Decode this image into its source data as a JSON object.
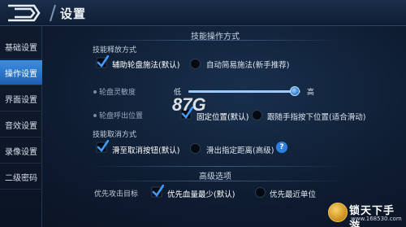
{
  "header": {
    "title": "设置"
  },
  "sidebar": {
    "items": [
      {
        "label": "基础设置",
        "active": false
      },
      {
        "label": "操作设置",
        "active": true
      },
      {
        "label": "界面设置",
        "active": false
      },
      {
        "label": "音效设置",
        "active": false
      },
      {
        "label": "录像设置",
        "active": false
      },
      {
        "label": "二级密码",
        "active": false
      }
    ]
  },
  "skill": {
    "title": "技能操作方式",
    "release": {
      "title": "技能释放方式",
      "option_a": "辅助轮盘施法(默认)",
      "option_b": "自动简易施法(新手推荐)",
      "selected": "option_a"
    },
    "sensitivity": {
      "label": "轮盘灵敏度",
      "min_label": "低",
      "max_label": "高",
      "value": 0.95
    },
    "wheel_position": {
      "label": "轮盘呼出位置",
      "option_a": "固定位置(默认)",
      "option_b": "跟随手指按下位置(适合滑动)",
      "selected": "option_a"
    },
    "cancel": {
      "title": "技能取消方式",
      "option_a": "滑至取消按钮(默认)",
      "option_b": "滑出指定距离(高级)",
      "selected": "option_a",
      "help": "?"
    }
  },
  "advanced": {
    "title": "高级选项",
    "target": {
      "label": "优先攻击目标",
      "option_a": "优先血量最少(默认)",
      "option_b": "优先最近单位",
      "selected": "option_a"
    }
  },
  "watermark": {
    "logo": "87G",
    "site_name": "锁天下手游",
    "site_url": "www.168530.com"
  },
  "colors": {
    "accent": "#2f7fe0",
    "check": "#3f9bff",
    "sidebar_active": "#2a74c9"
  }
}
